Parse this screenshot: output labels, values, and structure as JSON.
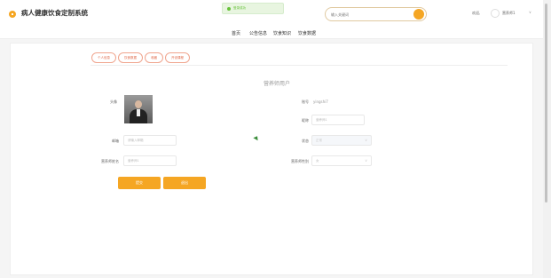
{
  "header": {
    "app_title": "病人健康饮食定制系统",
    "toast": "登录成功",
    "search_placeholder": "输入关键词",
    "greeting": "欢迎,",
    "user_name": "营养师1",
    "user_caret": "∨"
  },
  "nav": {
    "items": [
      {
        "label": "首页"
      },
      {
        "label": "公告信息"
      },
      {
        "label": "饮食知识"
      },
      {
        "label": "饮食数据"
      }
    ]
  },
  "tabs": [
    {
      "label": "个人信息"
    },
    {
      "label": "饮食数据"
    },
    {
      "label": "收藏"
    },
    {
      "label": "开设课程"
    }
  ],
  "page": {
    "title": "营养师用户"
  },
  "form": {
    "avatar_label": "头像",
    "account_label": "账号",
    "account_value": "yingshi7",
    "nickname_label": "昵称",
    "nickname_placeholder": "营养师1",
    "email_label": "邮箱",
    "email_placeholder": "请输入邮箱",
    "status_label": "状态",
    "status_value": "正常",
    "name_label": "营养师姓名",
    "name_placeholder": "营养师1",
    "gender_label": "营养师性别",
    "gender_value": "女",
    "caret": "∨"
  },
  "actions": {
    "save_label": "提交",
    "logout_label": "退出"
  },
  "colors": {
    "accent": "#f5a623",
    "tab_border": "#f0a58e",
    "toast_bg": "#e8f5e0"
  }
}
